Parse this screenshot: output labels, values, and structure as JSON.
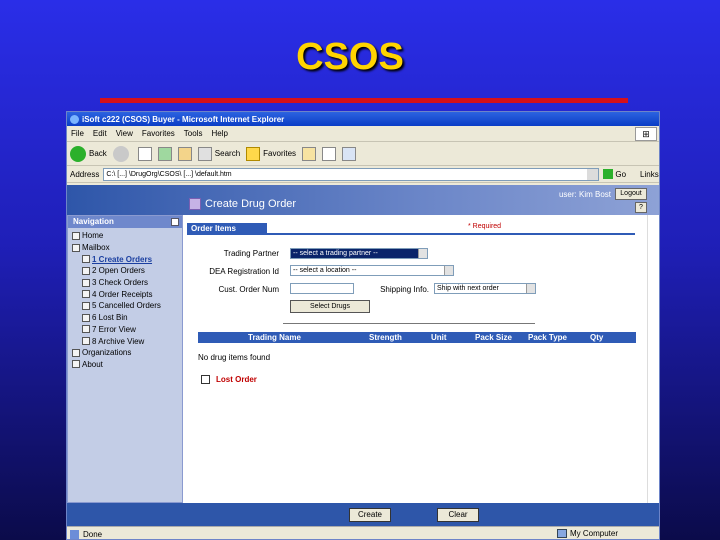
{
  "slide": {
    "title": "CSOS"
  },
  "browser": {
    "window_title": "iSoft c222 (CSOS) Buyer - Microsoft Internet Explorer",
    "menu": [
      "File",
      "Edit",
      "View",
      "Favorites",
      "Tools",
      "Help"
    ],
    "toolbar": {
      "back": "Back",
      "search": "Search",
      "favorites": "Favorites"
    },
    "address_label": "Address",
    "address_value": "C:\\ [...] \\DrugOrg\\CSOS\\ [...] \\default.htm",
    "go_label": "Go",
    "links_label": "Links",
    "status_text": "Done",
    "zone_text": "My Computer"
  },
  "app": {
    "page_title": "Create Drug Order",
    "user_text": "user: Kim Bost",
    "logout_label": "Logout",
    "help_label": "?",
    "nav": {
      "header": "Navigation",
      "items": [
        {
          "label": "Home"
        },
        {
          "label": "Mailbox"
        },
        {
          "label": "1 Create Orders"
        },
        {
          "label": "2 Open Orders"
        },
        {
          "label": "3 Check Orders"
        },
        {
          "label": "4 Order Receipts"
        },
        {
          "label": "5 Cancelled Orders"
        },
        {
          "label": "6 Lost Bin"
        },
        {
          "label": "7 Error View"
        },
        {
          "label": "8 Archive View"
        },
        {
          "label": "Organizations"
        },
        {
          "label": "About"
        }
      ]
    },
    "order_items": {
      "section_label": "Order Items",
      "required_label": "* Required",
      "trading_partner_label": "Trading Partner",
      "trading_partner_value": "-- select a trading partner --",
      "dea_label": "DEA Registration Id",
      "dea_value": "-- select a location --",
      "cust_order_label": "Cust. Order Num",
      "cust_order_value": "",
      "shipping_label": "Shipping Info.",
      "shipping_value": "Ship with next order",
      "select_drugs_label": "Select Drugs",
      "columns": [
        "Trading Name",
        "Strength",
        "Unit",
        "Pack Size",
        "Pack Type",
        "Qty"
      ],
      "empty_text": "No drug items found",
      "lost_order_label": "Lost Order"
    },
    "footer": {
      "create_label": "Create",
      "clear_label": "Clear"
    }
  }
}
